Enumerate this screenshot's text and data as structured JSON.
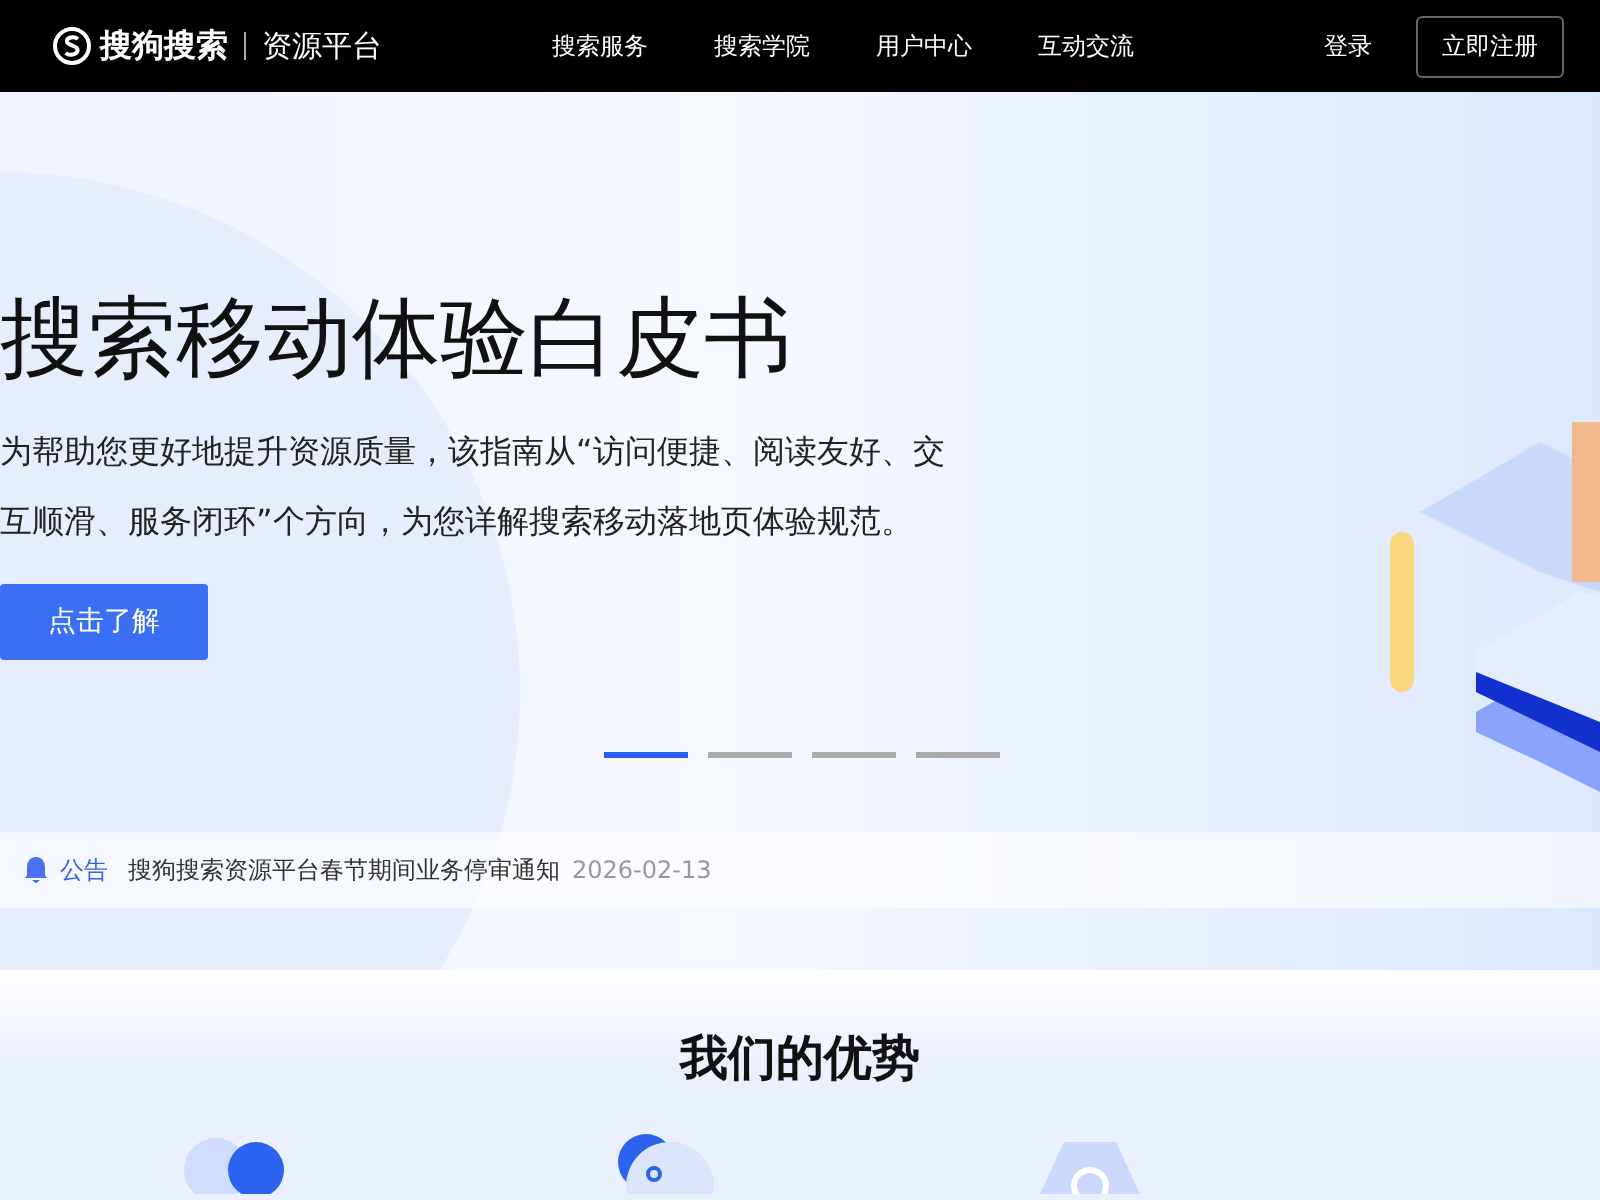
{
  "header": {
    "logo_text": "搜狗搜索",
    "platform": "资源平台",
    "nav": [
      {
        "label": "搜索服务"
      },
      {
        "label": "搜索学院"
      },
      {
        "label": "用户中心"
      },
      {
        "label": "互动交流"
      }
    ],
    "login": "登录",
    "register": "立即注册"
  },
  "hero": {
    "title": "搜索移动体验白皮书",
    "description": "为帮助您更好地提升资源质量，该指南从“访问便捷、阅读友好、交互顺滑、服务闭环”个方向，为您详解搜索移动落地页体验规范。",
    "button": "点击了解",
    "slides": [
      {
        "selected": true
      },
      {
        "selected": false
      },
      {
        "selected": false
      },
      {
        "selected": false
      }
    ]
  },
  "notice": {
    "label": "公告",
    "text": "搜狗搜索资源平台春节期间业务停审通知",
    "date": "2026-02-13"
  },
  "advantages": {
    "title": "我们的优势"
  }
}
